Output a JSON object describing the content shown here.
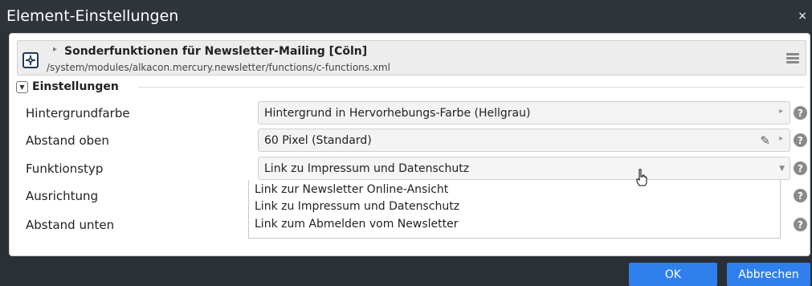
{
  "dialog": {
    "title": "Element-Einstellungen",
    "close_icon": "×"
  },
  "resource": {
    "title": "Sonderfunktionen für Newsletter-Mailing [Cöln]",
    "path": "/system/modules/alkacon.mercury.newsletter/functions/c-functions.xml"
  },
  "section": {
    "title": "Einstellungen"
  },
  "rows": [
    {
      "label": "Hintergrundfarbe",
      "value": "Hintergrund in Hervorhebungs-Farbe (Hellgrau)"
    },
    {
      "label": "Abstand oben",
      "value": "60 Pixel (Standard)"
    },
    {
      "label": "Funktionstyp",
      "value": "Link zu Impressum und Datenschutz"
    },
    {
      "label": "Ausrichtung",
      "value": ""
    },
    {
      "label": "Abstand unten",
      "value": ""
    }
  ],
  "dropdown_options": [
    "Link zur Newsletter Online-Ansicht",
    "Link zu Impressum und Datenschutz",
    "Link zum Abmelden vom Newsletter"
  ],
  "buttons": {
    "ok": "OK",
    "cancel": "Abbrechen"
  },
  "colors": {
    "accent": "#2f80ed",
    "titlebar": "#2f343a",
    "dark_background": "#2b3036"
  },
  "icons": {
    "resource": "gear-icon",
    "menu": "hamburger-icon",
    "help": "help-icon",
    "arrow": "arrow-right-icon",
    "pencil": "pencil-icon",
    "caret": "caret-down-icon",
    "toggle": "chevron-down-icon"
  },
  "glyphs": {
    "help": "?",
    "arrow": "▸",
    "pencil": "✎",
    "caret": "▼",
    "toggle": "▼"
  }
}
